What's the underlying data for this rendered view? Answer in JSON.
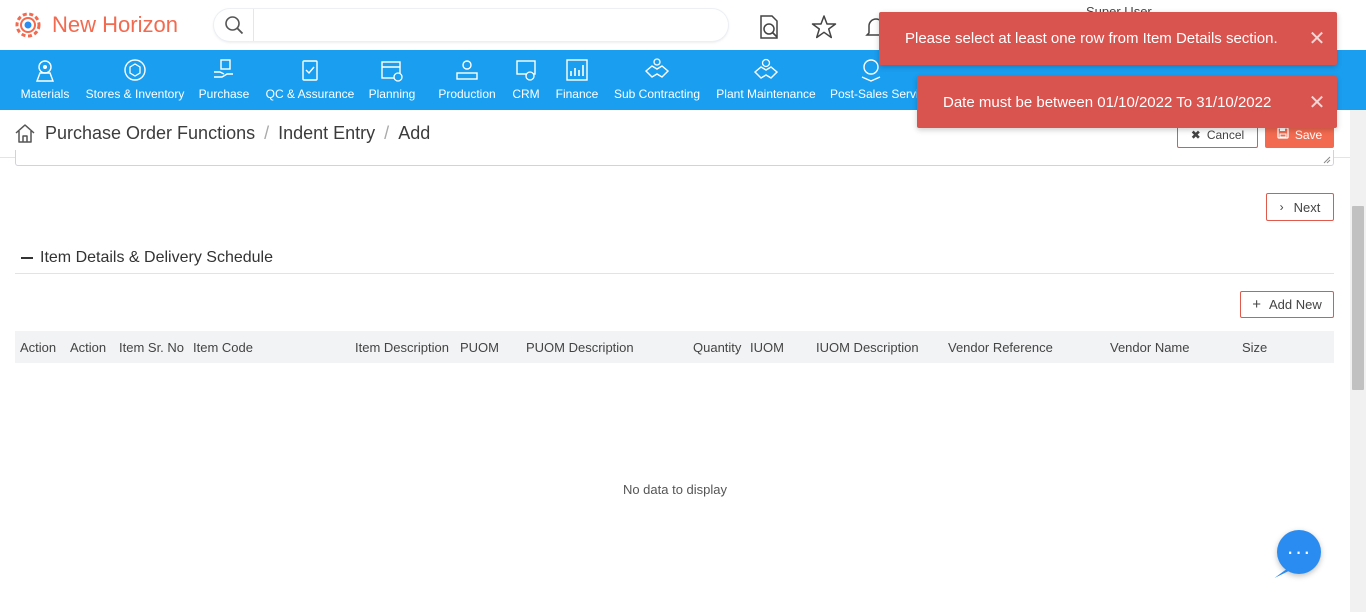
{
  "header": {
    "app_name": "New Horizon",
    "search_placeholder": "",
    "user_name": "Super User"
  },
  "nav": {
    "items": [
      {
        "label": "Materials",
        "icon": "materials-icon"
      },
      {
        "label": "Stores & Inventory",
        "icon": "stores-inventory-icon"
      },
      {
        "label": "Purchase",
        "icon": "purchase-icon"
      },
      {
        "label": "QC & Assurance",
        "icon": "qc-assurance-icon"
      },
      {
        "label": "Planning",
        "icon": "planning-icon"
      },
      {
        "label": "Production",
        "icon": "production-icon"
      },
      {
        "label": "CRM",
        "icon": "crm-icon"
      },
      {
        "label": "Finance",
        "icon": "finance-icon"
      },
      {
        "label": "Sub Contracting",
        "icon": "sub-contracting-icon"
      },
      {
        "label": "Plant Maintenance",
        "icon": "plant-maintenance-icon"
      },
      {
        "label": "Post-Sales Servic",
        "icon": "post-sales-service-icon"
      }
    ]
  },
  "breadcrumb": {
    "items": [
      "Purchase Order Functions",
      "Indent Entry",
      "Add"
    ],
    "separator": "/"
  },
  "actions": {
    "cancel_label": "Cancel",
    "save_label": "Save",
    "next_label": "Next",
    "add_new_label": "Add New"
  },
  "section": {
    "title": "Item Details & Delivery Schedule"
  },
  "grid": {
    "columns": [
      "Action",
      "Action",
      "Item Sr. No",
      "Item Code",
      "Item Description",
      "PUOM",
      "PUOM Description",
      "Quantity",
      "IUOM",
      "IUOM Description",
      "Vendor Reference",
      "Vendor Name",
      "Size"
    ],
    "empty_text": "No data to display"
  },
  "toasts": [
    {
      "message": "Please select at least one row from Item Details section.",
      "close": "✕"
    },
    {
      "message": "Date must be between 01/10/2022 To 31/10/2022",
      "close": "✕"
    }
  ],
  "chat": {
    "label": "···"
  },
  "colors": {
    "brand": "#f26a4f",
    "nav_bg": "#1a9ef0",
    "toast_bg": "#d9534f",
    "chat": "#2a8cf0"
  }
}
